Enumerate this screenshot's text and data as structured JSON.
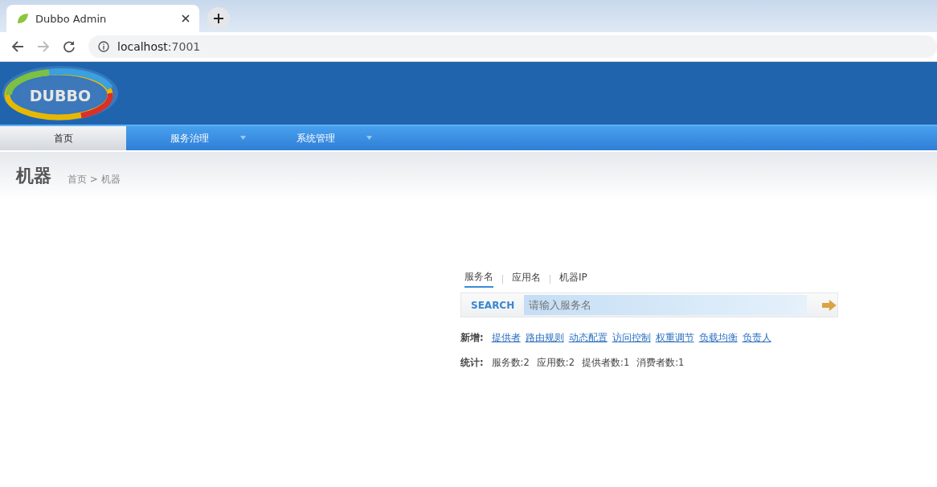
{
  "browser": {
    "tab_title": "Dubbo Admin",
    "url_host": "localhost",
    "url_port": ":7001"
  },
  "logo": {
    "text": "DUBBO"
  },
  "nav": [
    {
      "label": "首页",
      "selected": true,
      "dropdown": false
    },
    {
      "label": "服务治理",
      "selected": false,
      "dropdown": true
    },
    {
      "label": "系统管理",
      "selected": false,
      "dropdown": true
    }
  ],
  "page": {
    "title": "机器",
    "breadcrumb": "首页 > 机器"
  },
  "search": {
    "tabs": [
      {
        "label": "服务名",
        "selected": true
      },
      {
        "label": "应用名",
        "selected": false
      },
      {
        "label": "机器IP",
        "selected": false
      }
    ],
    "label": "SEARCH",
    "placeholder": "请输入服务名"
  },
  "add": {
    "label": "新增:",
    "links": [
      "提供者",
      "路由规则",
      "动态配置",
      "访问控制",
      "权重调节",
      "负载均衡",
      "负责人"
    ]
  },
  "stats": {
    "label": "统计:",
    "items": [
      "服务数:2",
      "应用数:2",
      "提供者数:1",
      "消费者数:1"
    ]
  }
}
